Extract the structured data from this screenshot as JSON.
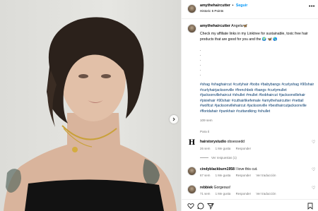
{
  "header": {
    "username": "amythehaircutter",
    "dot": "•",
    "follow_label": "Seguir",
    "subtitle": "Historic 5 Points",
    "more_icon": "more-horizontal-icon"
  },
  "caption": {
    "username": "amythehaircutter",
    "mention": "Angela🦋",
    "text": "Check my affiliate links in my Linktree for sustainable, toxic free hair products that are good for you and the 🌍 🦋 🌎",
    "dots": [
      ".",
      ".",
      ".",
      ".",
      ".",
      "."
    ],
    "hashtags": "#shag #shaghaircut #curlyhair #bobs #babybangs #curlyshag #90shair #curlyhairjacksonville #frenchbob #bangs #curlymullet #jacksonvillehaircut #shullet #mullet #bobhaircut #jacksonvillehair #pixiehair #90shair #cuthairlikefemale #amythehaircutter #nettail #wolfcut #jacksonvillehaircut #jacksonville #besthaircutjacksonville #floridahair #punkhair #cuttandking #shullet",
    "time": "109 sem"
  },
  "translate_label": "Para ti",
  "comments": [
    {
      "username": "hairstorystudio",
      "text": "obsessedd",
      "time": "26 sem",
      "likes": "1 Me gusta",
      "reply": "Responder",
      "replies_label": "Ver respuestas (1)"
    },
    {
      "username": "cindyblackburn1958",
      "text": "I love this cut.",
      "time": "67 sem",
      "likes": "1 Me gusta",
      "reply": "Responder",
      "translate": "Ver traducción"
    },
    {
      "username": "rebbiek",
      "text": "Gorgeous!",
      "time": "71 sem",
      "likes": "1 Me gusta",
      "reply": "Responder",
      "translate": "Ver traducción"
    }
  ],
  "icons": {
    "verified": "verified-badge-icon",
    "heart": "heart-icon",
    "comment": "comment-icon",
    "share": "share-icon",
    "save": "bookmark-icon",
    "next": "chevron-right-icon"
  },
  "colors": {
    "link_blue": "#0095f6",
    "hashtag": "#00376b",
    "muted": "#737373"
  }
}
